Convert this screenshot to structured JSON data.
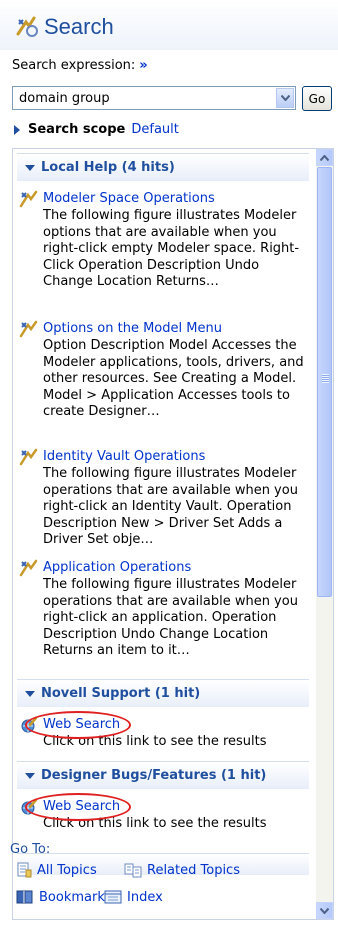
{
  "header": {
    "title": "Search"
  },
  "search": {
    "expression_label": "Search expression:",
    "expression_chevron": "»",
    "query": "domain group",
    "go_label": "Go"
  },
  "scope": {
    "label": "Search scope",
    "value": "Default"
  },
  "sections": {
    "local_help": {
      "title": "Local Help (4 hits)",
      "hits": [
        {
          "title": "Modeler Space Operations",
          "desc": "The following figure illustrates Modeler options that are available when you right-click empty Modeler space. Right-Click Operation Description Undo Change Location Returns…"
        },
        {
          "title": "Options on the Model Menu",
          "desc": "Option Description Model Accesses the Modeler applications, tools, drivers, and other resources. See Creating a Model. Model > Application Accesses tools to create Designer…"
        },
        {
          "title": "Identity Vault Operations",
          "desc": "The following figure illustrates Modeler operations that are available when you right-click an Identity Vault. Operation Description New > Driver Set Adds a Driver Set obje…"
        },
        {
          "title": "Application Operations",
          "desc": "The following figure illustrates Modeler operations that are available when you right-click an application. Operation Description Undo Change Location Returns an item to it…"
        }
      ]
    },
    "novell_support": {
      "title": "Novell Support (1 hit)",
      "hit": {
        "title": "Web Search",
        "desc": "Click on this link to see the results"
      }
    },
    "designer_bugs": {
      "title": "Designer Bugs/Features (1 hit)",
      "hit": {
        "title": "Web Search",
        "desc": "Click on this link to see the results"
      }
    }
  },
  "goto": {
    "label": "Go To:",
    "links": {
      "all_topics": "All Topics",
      "related_topics": "Related Topics",
      "bookmarks": "Bookmarks",
      "index": "Index"
    }
  },
  "icons": {
    "title": "search-title-icon",
    "hit": "help-topic-icon",
    "web": "web-search-icon"
  },
  "colors": {
    "accent": "#1f4f9e",
    "link": "#0033cc",
    "annotation": "#e02020"
  }
}
